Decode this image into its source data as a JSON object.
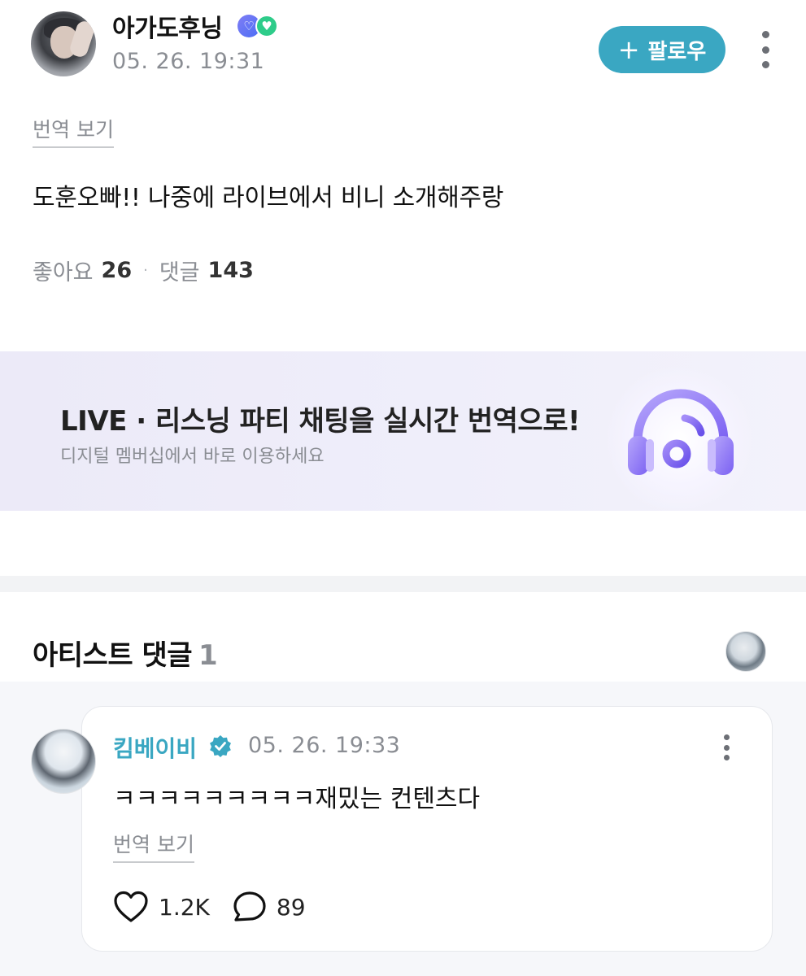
{
  "post": {
    "author_name": "아가도후닝",
    "timestamp": "05. 26. 19:31",
    "follow_label": "팔로우",
    "translate_label": "번역 보기",
    "body": "도훈오빠!! 나중에 라이브에서 비니 소개해주랑",
    "likes_label": "좋아요",
    "likes_count": "26",
    "comments_label": "댓글",
    "comments_count": "143"
  },
  "banner": {
    "title": "LIVE · 리스닝 파티 채팅을 실시간 번역으로!",
    "subtitle": "디지털 멤버십에서 바로 이용하세요",
    "icon": "headphones-music-icon"
  },
  "artist_comments": {
    "heading": "아티스트 댓글",
    "count": "1",
    "items": [
      {
        "author": "킴베이비",
        "timestamp": "05. 26. 19:33",
        "text": "ㅋㅋㅋㅋㅋㅋㅋㅋㅋ재밌는 컨텐츠다",
        "translate_label": "번역 보기",
        "likes": "1.2K",
        "replies": "89"
      }
    ]
  },
  "colors": {
    "accent": "#3aa7c2",
    "muted_text": "#8a8d93",
    "banner_bg": "#eceaf8",
    "headphone_purple": "#8f7cf7"
  }
}
